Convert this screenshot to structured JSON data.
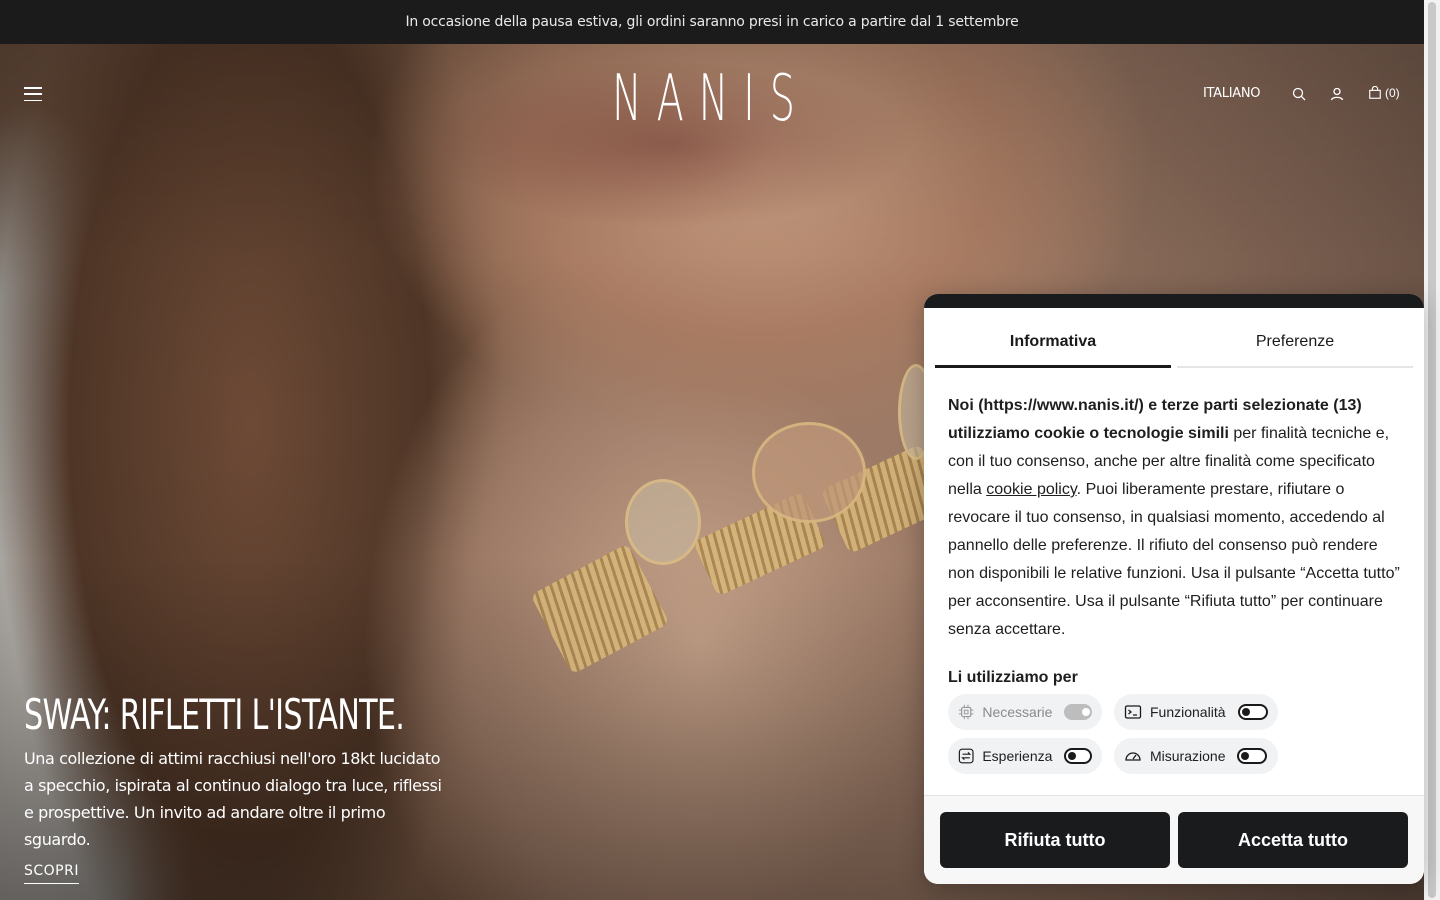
{
  "announcement": "In occasione della pausa estiva, gli ordini saranno presi in carico a partire dal 1 settembre",
  "header": {
    "logo": "NANIS",
    "language": "ITALIANO",
    "cart_count": "(0)",
    "icons": [
      "hamburger-menu-icon",
      "search-icon",
      "user-icon",
      "shopping-bag-icon"
    ]
  },
  "hero": {
    "title": "SWAY: RIFLETTI L'ISTANTE.",
    "description": "Una collezione di attimi racchiusi nell'oro 18kt lucidato a specchio, ispirata al continuo dialogo tra luce, riflessi e prospettive. Un invito ad andare oltre il primo sguardo.",
    "cta": "SCOPRI"
  },
  "cookie_banner": {
    "tabs": [
      {
        "label": "Informativa",
        "active": true
      },
      {
        "label": "Preferenze",
        "active": false
      }
    ],
    "body_bold": "Noi (https://www.nanis.it/) e terze parti selezionate (13) utilizziamo cookie o tecnologie simili",
    "body_part1": " per finalità tecniche e, con il tuo consenso, anche per altre finalità come specificato nella ",
    "cookie_policy_link": "cookie policy",
    "body_part2": ". Puoi liberamente prestare, rifiutare o revocare il tuo consenso, in qualsiasi momento, accedendo al pannello delle preferenze. Il rifiuto del consenso può rendere non disponibili le relative funzioni. Usa il pulsante “Accetta tutto” per acconsentire. Usa il pulsante “Rifiuta tutto” per continuare senza accettare.",
    "use_title": "Li utilizziamo per",
    "purposes": [
      {
        "label": "Necessarie",
        "enabled": true,
        "locked": true,
        "icon": "chip-icon"
      },
      {
        "label": "Funzionalità",
        "enabled": false,
        "locked": false,
        "icon": "terminal-icon"
      },
      {
        "label": "Esperienza",
        "enabled": false,
        "locked": false,
        "icon": "arrows-swap-icon"
      },
      {
        "label": "Misurazione",
        "enabled": false,
        "locked": false,
        "icon": "gauge-icon"
      }
    ],
    "reject_label": "Rifiuta tutto",
    "accept_label": "Accetta tutto"
  },
  "colors": {
    "banner_bg": "#1b1b1b",
    "button_bg": "#1a1b1d",
    "panel_bg": "#ffffff"
  }
}
